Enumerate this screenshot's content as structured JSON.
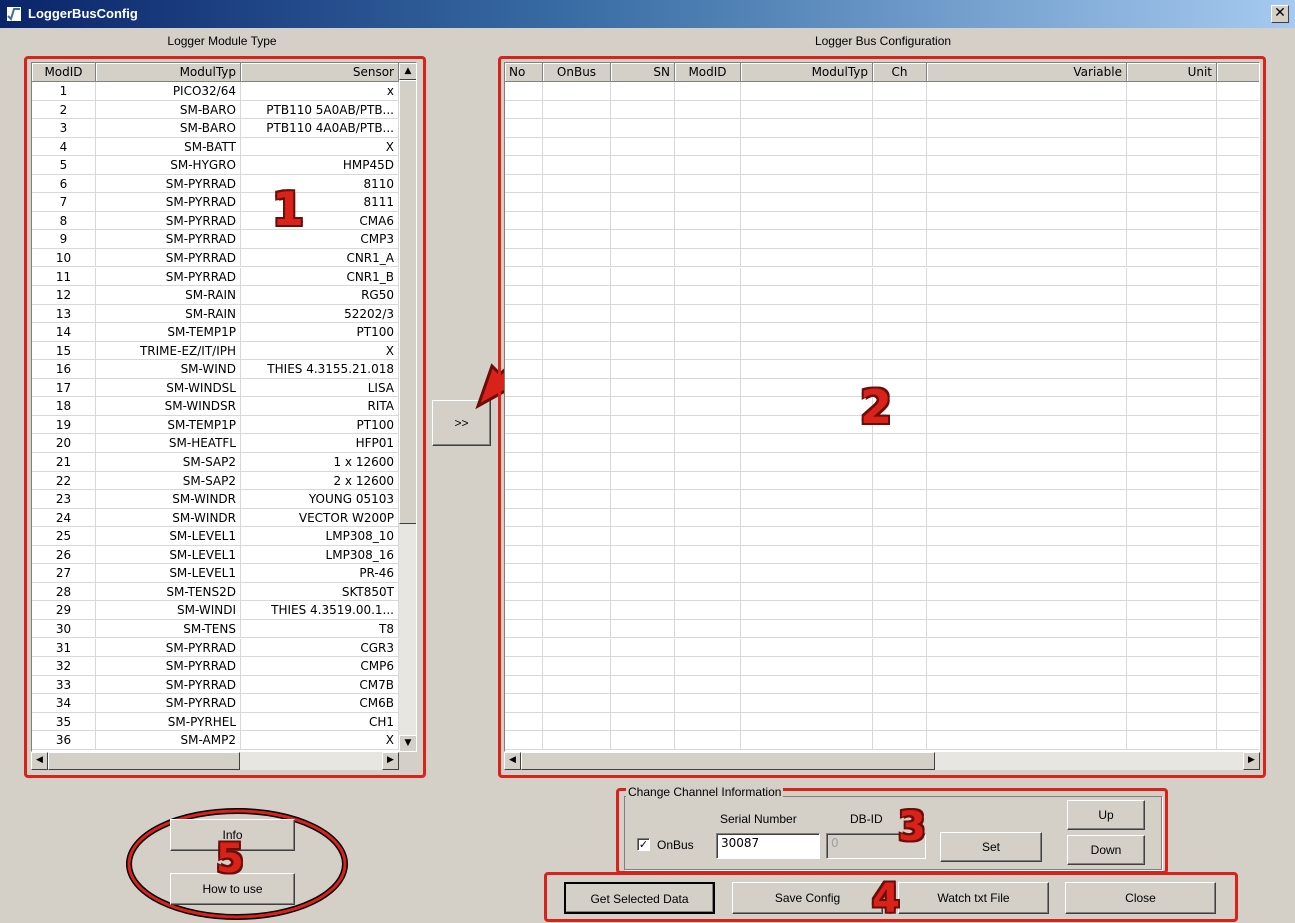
{
  "window": {
    "title": "LoggerBusConfig",
    "close_glyph": "✕"
  },
  "left_panel": {
    "label": "Logger Module Type",
    "columns": [
      "ModID",
      "ModulTyp",
      "Sensor"
    ],
    "rows": [
      [
        "1",
        "PICO32/64",
        "x"
      ],
      [
        "2",
        "SM-BARO",
        "PTB110 5A0AB/PTB..."
      ],
      [
        "3",
        "SM-BARO",
        "PTB110 4A0AB/PTB..."
      ],
      [
        "4",
        "SM-BATT",
        "X"
      ],
      [
        "5",
        "SM-HYGRO",
        "HMP45D"
      ],
      [
        "6",
        "SM-PYRRAD",
        "8110"
      ],
      [
        "7",
        "SM-PYRRAD",
        "8111"
      ],
      [
        "8",
        "SM-PYRRAD",
        "CMA6"
      ],
      [
        "9",
        "SM-PYRRAD",
        "CMP3"
      ],
      [
        "10",
        "SM-PYRRAD",
        "CNR1_A"
      ],
      [
        "11",
        "SM-PYRRAD",
        "CNR1_B"
      ],
      [
        "12",
        "SM-RAIN",
        "RG50"
      ],
      [
        "13",
        "SM-RAIN",
        "52202/3"
      ],
      [
        "14",
        "SM-TEMP1P",
        "PT100"
      ],
      [
        "15",
        "TRIME-EZ/IT/IPH",
        "X"
      ],
      [
        "16",
        "SM-WIND",
        "THIES 4.3155.21.018"
      ],
      [
        "17",
        "SM-WINDSL",
        "LISA"
      ],
      [
        "18",
        "SM-WINDSR",
        "RITA"
      ],
      [
        "19",
        "SM-TEMP1P",
        "PT100"
      ],
      [
        "20",
        "SM-HEATFL",
        "HFP01"
      ],
      [
        "21",
        "SM-SAP2",
        "1 x 12600"
      ],
      [
        "22",
        "SM-SAP2",
        "2 x 12600"
      ],
      [
        "23",
        "SM-WINDR",
        "YOUNG 05103"
      ],
      [
        "24",
        "SM-WINDR",
        "VECTOR W200P"
      ],
      [
        "25",
        "SM-LEVEL1",
        "LMP308_10"
      ],
      [
        "26",
        "SM-LEVEL1",
        "LMP308_16"
      ],
      [
        "27",
        "SM-LEVEL1",
        "PR-46"
      ],
      [
        "28",
        "SM-TENS2D",
        "SKT850T"
      ],
      [
        "29",
        "SM-WINDI",
        "THIES 4.3519.00.1..."
      ],
      [
        "30",
        "SM-TENS",
        "T8"
      ],
      [
        "31",
        "SM-PYRRAD",
        "CGR3"
      ],
      [
        "32",
        "SM-PYRRAD",
        "CMP6"
      ],
      [
        "33",
        "SM-PYRRAD",
        "CM7B"
      ],
      [
        "34",
        "SM-PYRRAD",
        "CM6B"
      ],
      [
        "35",
        "SM-PYRHEL",
        "CH1"
      ],
      [
        "36",
        "SM-AMP2",
        "X"
      ]
    ]
  },
  "right_panel": {
    "label": "Logger Bus Configuration",
    "columns": [
      "No",
      "OnBus",
      "SN",
      "ModID",
      "ModulTyp",
      "Ch",
      "Variable",
      "Unit"
    ]
  },
  "transfer_button": {
    "label": ">>"
  },
  "change_channel": {
    "title": "Change Channel Information",
    "onbus_label": "OnBus",
    "onbus_checked": "✓",
    "serial_label": "Serial Number",
    "serial_value": "30087",
    "dbid_label": "DB-ID",
    "dbid_value": "0",
    "set_label": "Set",
    "up_label": "Up",
    "down_label": "Down"
  },
  "bottom_buttons": {
    "get_selected": "Get Selected Data",
    "save_config": "Save Config",
    "watch_txt": "Watch txt File",
    "close": "Close"
  },
  "help_buttons": {
    "info": "Info",
    "how_to_use": "How to use"
  },
  "annotations": {
    "n1": "1",
    "n2": "2",
    "n3": "3",
    "n4": "4",
    "n5a": "5",
    "n5b": "5"
  },
  "colors": {
    "annotation_red": "#d9221a",
    "window_bg": "#d4d0c8",
    "title_dark": "#0a246a"
  }
}
